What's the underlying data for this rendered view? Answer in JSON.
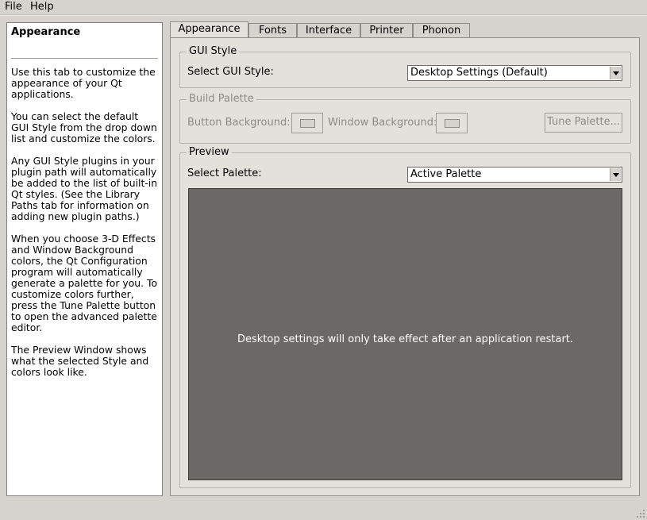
{
  "menubar": {
    "file": "File",
    "help": "Help"
  },
  "help_panel": {
    "title": "Appearance",
    "paragraphs": [
      "Use this tab to customize the appearance of your Qt applications.",
      "You can select the default GUI Style from the drop down list and customize the colors.",
      "Any GUI Style plugins in your plugin path will automatically be added to the list of built-in Qt styles. (See the Library Paths tab for information on adding new plugin paths.)",
      "When you choose 3-D Effects and Window Background colors, the Qt Configuration program will automatically generate a palette for you. To customize colors further, press the Tune Palette button to open the advanced palette editor.",
      "The Preview Window shows what the selected Style and colors look like."
    ]
  },
  "tabs": [
    {
      "label": "Appearance",
      "active": true
    },
    {
      "label": "Fonts",
      "active": false
    },
    {
      "label": "Interface",
      "active": false
    },
    {
      "label": "Printer",
      "active": false
    },
    {
      "label": "Phonon",
      "active": false
    }
  ],
  "gui_style": {
    "group_title": "GUI Style",
    "select_label": "Select GUI Style:",
    "selected_value": "Desktop Settings (Default)"
  },
  "build_palette": {
    "group_title": "Build Palette",
    "button_background_label": "Button Background:",
    "window_background_label": "Window Background:",
    "tune_palette_label": "Tune Palette...",
    "enabled": false
  },
  "preview": {
    "group_title": "Preview",
    "select_label": "Select Palette:",
    "selected_value": "Active Palette",
    "message": "Desktop settings will only take effect after an application restart."
  },
  "colors": {
    "window_bg": "#d6d3ce",
    "tab_page_bg": "#e4e1dc",
    "preview_bg": "#6a6966",
    "disabled_text": "#8d8a85"
  }
}
